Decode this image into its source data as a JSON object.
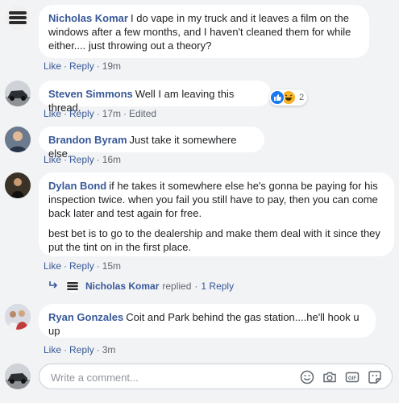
{
  "labels": {
    "like": "Like",
    "reply": "Reply",
    "dot": "·"
  },
  "comments": [
    {
      "author": "Nicholas Komar",
      "text": "I do vape in my truck and it leaves a film on the windows after a few months, and I haven't cleaned them for while either.... just throwing out a theory?",
      "time": "19m",
      "avatar": "striped-logo-avatar"
    },
    {
      "author": "Steven Simmons",
      "text": "Well I am leaving this thread.",
      "time": "17m",
      "edited": "Edited",
      "reactions": {
        "count": "2",
        "types": [
          "like-reaction-icon",
          "haha-reaction-icon"
        ]
      },
      "avatar": "car-photo-avatar"
    },
    {
      "author": "Brandon Byram",
      "text": "Just take it somewhere else.",
      "time": "16m",
      "avatar": "person-photo-avatar"
    },
    {
      "author": "Dylan Bond",
      "text": "if he takes it somewhere else he's gonna be paying for his inspection twice. when you fail you still have to pay, then you can come back later and test again for free.",
      "text2": "best bet is to go to the dealership and make them deal with it since they put the tint on in the first place.",
      "time": "15m",
      "avatar": "person-photo-avatar"
    },
    {
      "author": "Ryan Gonzales",
      "text": "Coit and Park behind the gas station....he'll hook u up",
      "time": "3m",
      "avatar": "group-photo-avatar"
    }
  ],
  "reply_summary": {
    "name": "Nicholas Komar",
    "action": "replied",
    "count": "1 Reply"
  },
  "composer": {
    "placeholder": "Write a comment...",
    "tools": [
      "emoji-icon",
      "camera-icon",
      "gif-icon",
      "sticker-icon"
    ]
  },
  "colors": {
    "author": "#385898",
    "background": "#f2f3f5",
    "bubble": "#ffffff",
    "meta": "#606770"
  }
}
